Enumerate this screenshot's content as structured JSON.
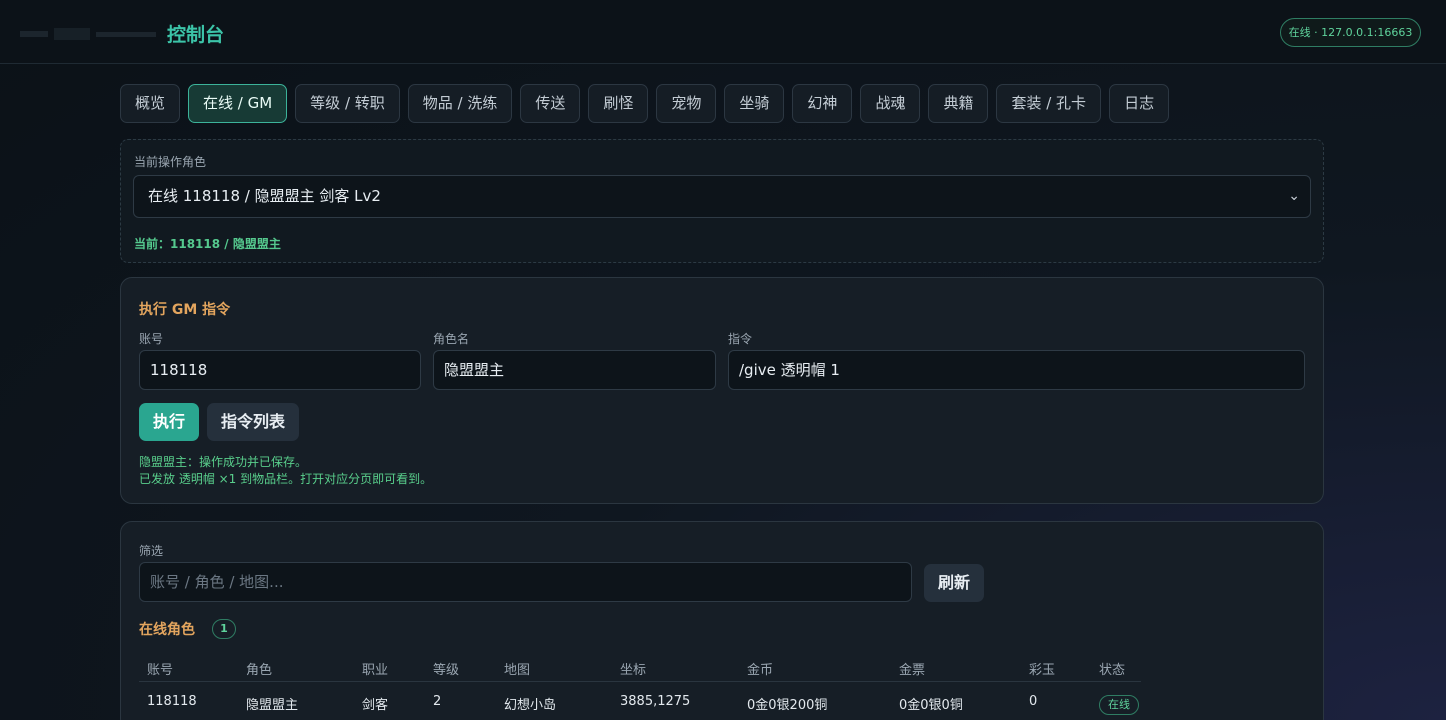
{
  "header": {
    "title": "控制台",
    "server_status": "在线 · 127.0.0.1:16663"
  },
  "tabs": [
    {
      "label": "概览"
    },
    {
      "label": "在线 / GM",
      "active": true
    },
    {
      "label": "等级 / 转职"
    },
    {
      "label": "物品 / 洗练"
    },
    {
      "label": "传送"
    },
    {
      "label": "刷怪"
    },
    {
      "label": "宠物"
    },
    {
      "label": "坐骑"
    },
    {
      "label": "幻神"
    },
    {
      "label": "战魂"
    },
    {
      "label": "典籍"
    },
    {
      "label": "套装 / 孔卡"
    },
    {
      "label": "日志"
    }
  ],
  "role_panel": {
    "label": "当前操作角色",
    "selected": "在线 118118 / 隐盟盟主 剑客 Lv2",
    "current": "当前：118118 / 隐盟盟主"
  },
  "gm": {
    "title": "执行 GM 指令",
    "account_label": "账号",
    "account_value": "118118",
    "role_label": "角色名",
    "role_value": "隐盟盟主",
    "command_label": "指令",
    "command_value": "/give 透明帽 1",
    "execute_label": "执行",
    "command_list_label": "指令列表",
    "result_line1": "隐盟盟主：操作成功并已保存。",
    "result_line2": "已发放 透明帽 ×1 到物品栏。打开对应分页即可看到。"
  },
  "filter": {
    "label": "筛选",
    "placeholder": "账号 / 角色 / 地图...",
    "refresh_label": "刷新",
    "online_title": "在线角色",
    "online_count": "1"
  },
  "table": {
    "headers": [
      "账号",
      "角色",
      "职业",
      "等级",
      "地图",
      "坐标",
      "金币",
      "金票",
      "彩玉",
      "状态"
    ],
    "rows": [
      {
        "account": "118118",
        "role": "隐盟盟主",
        "class": "剑客",
        "level": "2",
        "map": "幻想小岛",
        "coords": "3885,1275",
        "gold": "0金0银200铜",
        "ticket": "0金0银0铜",
        "jade": "0",
        "status": "在线"
      }
    ]
  },
  "colors": {
    "accent": "#2aa690",
    "heading": "#e3a55e",
    "success": "#59cf8c"
  }
}
